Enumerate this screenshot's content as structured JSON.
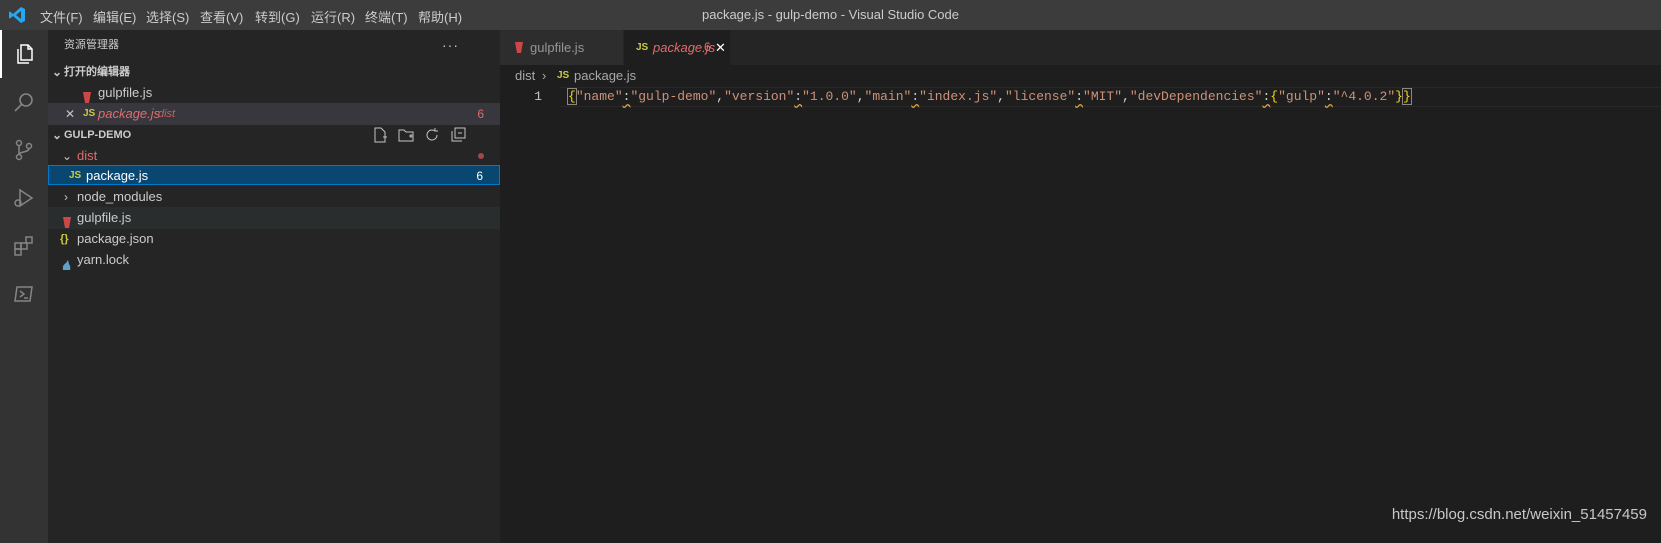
{
  "titlebar": {
    "menu": [
      "文件(F)",
      "编辑(E)",
      "选择(S)",
      "查看(V)",
      "转到(G)",
      "运行(R)",
      "终端(T)",
      "帮助(H)"
    ],
    "window_title": "package.js - gulp-demo - Visual Studio Code"
  },
  "activitybar": {
    "icons": [
      "explorer-icon",
      "search-icon",
      "source-control-icon",
      "run-debug-icon",
      "extensions-icon",
      "remote-icon"
    ]
  },
  "sidebar": {
    "title": "资源管理器",
    "more": "···",
    "open_editors": {
      "header": "打开的编辑器",
      "items": [
        {
          "name": "gulpfile.js",
          "icon": "gulp-icon"
        },
        {
          "name": "package.js",
          "description": "dist",
          "count": "6",
          "close": "✕"
        }
      ]
    },
    "project": {
      "header": "GULP-DEMO",
      "tree": [
        {
          "name": "dist",
          "type": "folder",
          "expanded": true
        },
        {
          "name": "package.js",
          "type": "file",
          "icon": "JS",
          "count": "6"
        },
        {
          "name": "node_modules",
          "type": "folder",
          "expanded": false
        },
        {
          "name": "gulpfile.js",
          "type": "file",
          "icon": "gulp-icon"
        },
        {
          "name": "package.json",
          "type": "file",
          "icon": "{}"
        },
        {
          "name": "yarn.lock",
          "type": "file",
          "icon": "yarn-icon"
        }
      ]
    }
  },
  "tabs": [
    {
      "name": "gulpfile.js",
      "active": false
    },
    {
      "name": "package.js",
      "count": "6",
      "active": true,
      "close": "✕"
    }
  ],
  "breadcrumbs": {
    "folder": "dist",
    "file": "package.js",
    "file_icon": "JS"
  },
  "editor": {
    "line_number": "1",
    "tokens": [
      "{",
      "\"name\"",
      ":",
      "\"gulp-demo\"",
      ",",
      "\"version\"",
      ":",
      "\"1.0.0\"",
      ",",
      "\"main\"",
      ":",
      "\"index.js\"",
      ",",
      "\"license\"",
      ":",
      "\"MIT\"",
      ",",
      "\"devDependencies\"",
      ":",
      "{",
      "\"gulp\"",
      ":",
      "\"^4.0.2\"",
      "}",
      "}"
    ]
  },
  "watermark": "https://blog.csdn.net/weixin_51457459",
  "colors": {
    "error": "#e06c6c",
    "selection": "#094771",
    "accent": "#007acc",
    "js": "#cbcb41"
  }
}
